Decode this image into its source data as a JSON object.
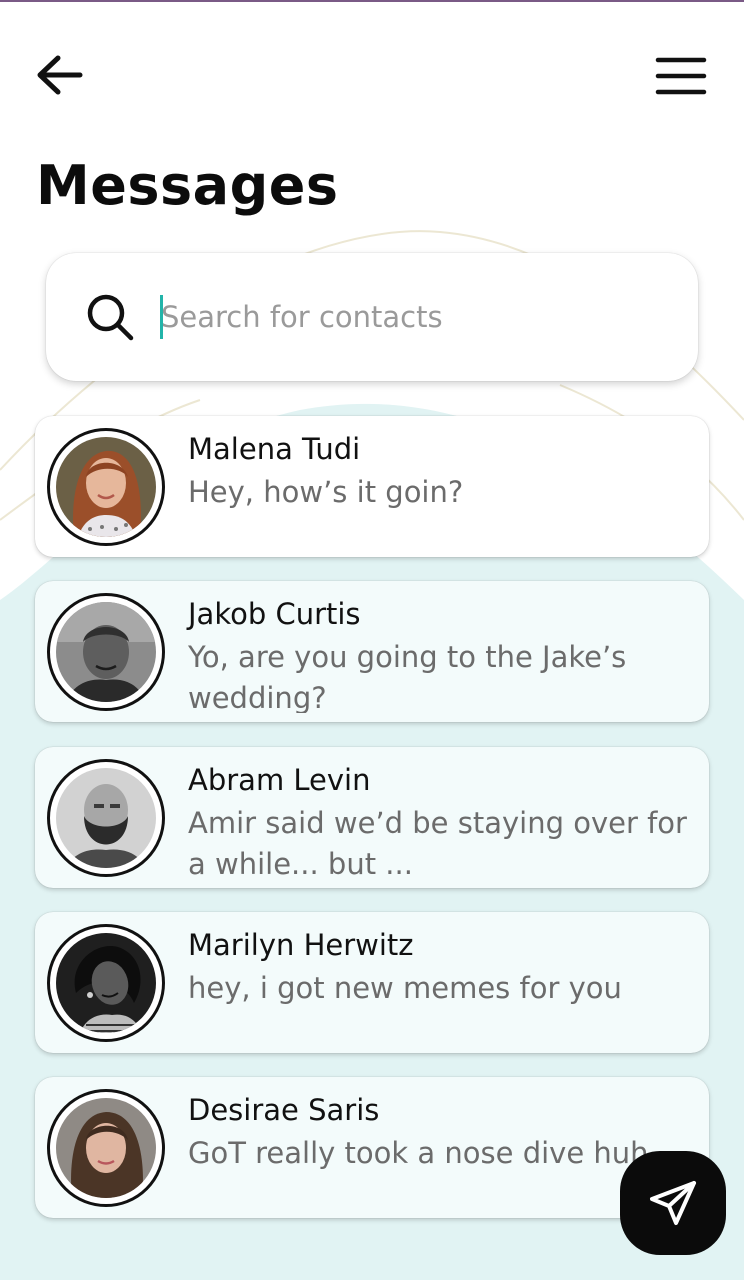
{
  "header": {
    "title": "Messages",
    "back_icon": "arrow-left-icon",
    "menu_icon": "hamburger-menu-icon"
  },
  "search": {
    "placeholder": "Search for contacts",
    "value": "",
    "icon": "search-icon"
  },
  "contacts": [
    {
      "name": "Malena Tudi",
      "preview": "Hey, how’s it goin?",
      "avatar": "avatar-photo-woman-red-hair"
    },
    {
      "name": "Jakob Curtis",
      "preview": "Yo, are you going to the Jake’s wedding?",
      "avatar": "avatar-photo-man-bw"
    },
    {
      "name": "Abram Levin",
      "preview": "Amir said we’d be staying over for a while... but ...",
      "avatar": "avatar-photo-man-beard-bw"
    },
    {
      "name": "Marilyn Herwitz",
      "preview": "hey, i got new memes for you",
      "avatar": "avatar-photo-woman-bw"
    },
    {
      "name": "Desirae Saris",
      "preview": "GoT really took a nose dive huh",
      "avatar": "avatar-photo-woman-brown-hair"
    }
  ],
  "fab": {
    "icon": "send-paper-plane-icon"
  },
  "colors": {
    "accent": "#22b4a9",
    "background_blob": "#e1f3f3",
    "card_tint": "#f3fbfb",
    "text_primary": "#111111",
    "text_secondary": "#6b6b6b"
  }
}
